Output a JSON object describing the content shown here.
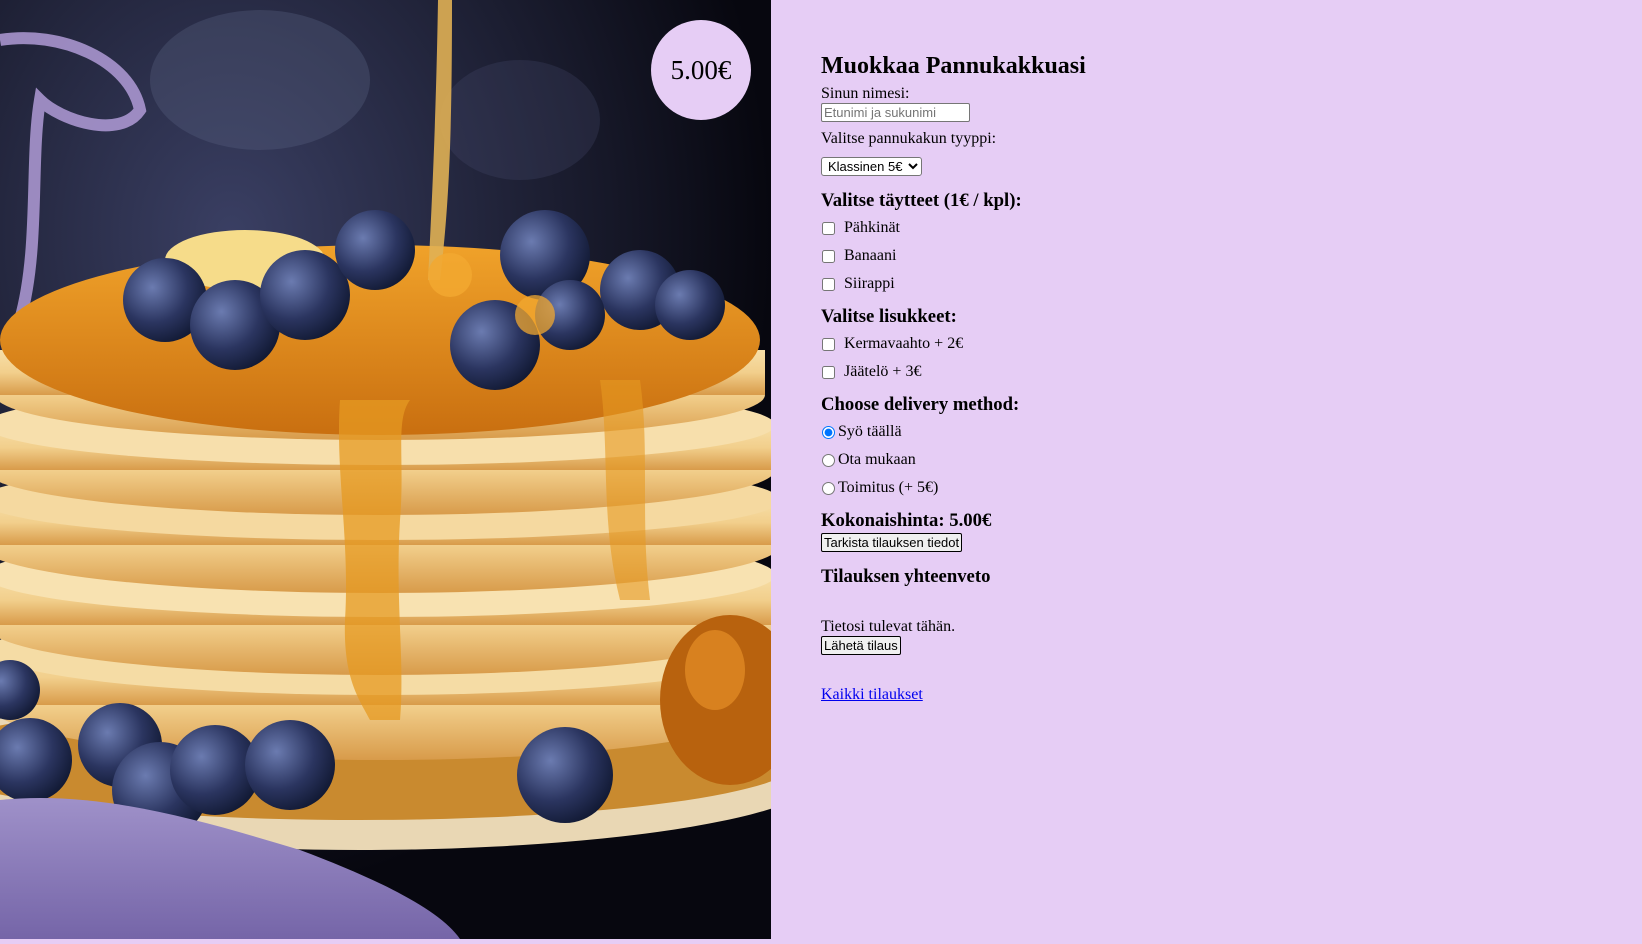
{
  "hero": {
    "price_badge": "5.00€"
  },
  "form": {
    "title": "Muokkaa Pannukakkuasi",
    "name_label": "Sinun nimesi:",
    "name_placeholder": "Etunimi ja sukunimi",
    "name_value": "",
    "type_label": "Valitse pannukakun tyyppi:",
    "type_selected": "Klassinen 5€",
    "toppings_heading": "Valitse täytteet (1€ / kpl):",
    "toppings": [
      {
        "label": "Pähkinät",
        "checked": false
      },
      {
        "label": "Banaani",
        "checked": false
      },
      {
        "label": "Siirappi",
        "checked": false
      }
    ],
    "extras_heading": "Valitse lisukkeet:",
    "extras": [
      {
        "label": "Kermavaahto + 2€",
        "checked": false
      },
      {
        "label": "Jäätelö + 3€",
        "checked": false
      }
    ],
    "delivery_heading": "Choose delivery method:",
    "delivery": [
      {
        "label": "Syö täällä",
        "checked": true
      },
      {
        "label": "Ota mukaan",
        "checked": false
      },
      {
        "label": "Toimitus (+ 5€)",
        "checked": false
      }
    ],
    "total_label": "Kokonaishinta: 5.00€",
    "check_button": "Tarkista tilauksen tiedot",
    "summary_heading": "Tilauksen yhteenveto",
    "summary_text": "Tietosi tulevat tähän.",
    "send_button": "Lähetä tilaus",
    "all_orders_link": "Kaikki tilaukset"
  },
  "colors": {
    "background": "#e6cdf5",
    "link": "#0000ee"
  }
}
